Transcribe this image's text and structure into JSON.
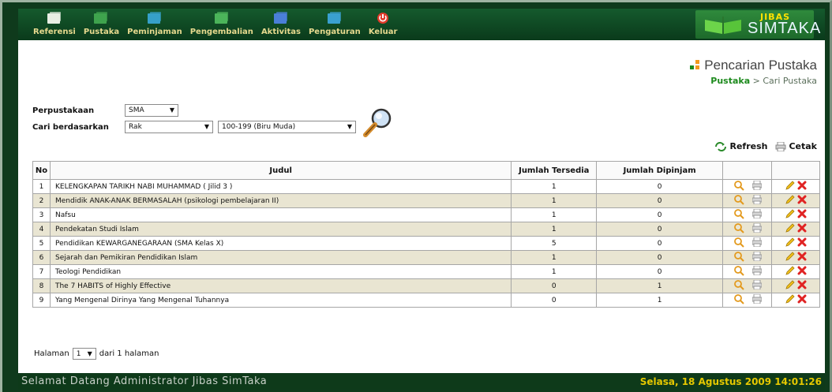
{
  "nav": {
    "items": [
      {
        "label": "Referensi",
        "icon": "referensi-icon"
      },
      {
        "label": "Pustaka",
        "icon": "pustaka-icon"
      },
      {
        "label": "Peminjaman",
        "icon": "peminjaman-icon"
      },
      {
        "label": "Pengembalian",
        "icon": "pengembalian-icon"
      },
      {
        "label": "Aktivitas",
        "icon": "aktivitas-icon"
      },
      {
        "label": "Pengaturan",
        "icon": "pengaturan-icon"
      },
      {
        "label": "Keluar",
        "icon": "power-icon"
      }
    ]
  },
  "logo": {
    "top": "JIBAS",
    "main": "SIMTAKA"
  },
  "page": {
    "title": "Pencarian Pustaka",
    "breadcrumb_link": "Pustaka",
    "breadcrumb_sep": " > ",
    "breadcrumb_current": "Cari Pustaka"
  },
  "filters": {
    "perpustakaan_label": "Perpustakaan",
    "perpustakaan_value": "SMA",
    "cari_label": "Cari berdasarkan",
    "cari_value": "Rak",
    "rak_value": "100-199 (Biru Muda)"
  },
  "actions": {
    "refresh": "Refresh",
    "cetak": "Cetak"
  },
  "table": {
    "headers": {
      "no": "No",
      "judul": "Judul",
      "tersedia": "Jumlah Tersedia",
      "dipinjam": "Jumlah Dipinjam"
    },
    "rows": [
      {
        "no": "1",
        "judul": "KELENGKAPAN TARIKH NABI MUHAMMAD ( Jilid 3 )",
        "tersedia": "1",
        "dipinjam": "0"
      },
      {
        "no": "2",
        "judul": "Mendidik ANAK-ANAK BERMASALAH (psikologi pembelajaran II)",
        "tersedia": "1",
        "dipinjam": "0"
      },
      {
        "no": "3",
        "judul": "Nafsu",
        "tersedia": "1",
        "dipinjam": "0"
      },
      {
        "no": "4",
        "judul": "Pendekatan Studi Islam",
        "tersedia": "1",
        "dipinjam": "0"
      },
      {
        "no": "5",
        "judul": "Pendidikan KEWARGANEGARAAN (SMA Kelas X)",
        "tersedia": "5",
        "dipinjam": "0"
      },
      {
        "no": "6",
        "judul": "Sejarah dan Pemikiran Pendidikan Islam",
        "tersedia": "1",
        "dipinjam": "0"
      },
      {
        "no": "7",
        "judul": "Teologi Pendidikan",
        "tersedia": "1",
        "dipinjam": "0"
      },
      {
        "no": "8",
        "judul": "The 7 HABITS of Highly Effective",
        "tersedia": "0",
        "dipinjam": "1"
      },
      {
        "no": "9",
        "judul": "Yang Mengenal Dirinya Yang Mengenal Tuhannya",
        "tersedia": "0",
        "dipinjam": "1"
      }
    ]
  },
  "pager": {
    "prefix": "Halaman",
    "value": "1",
    "suffix": "dari 1 halaman"
  },
  "footer": {
    "welcome": "Selamat Datang Administrator Jibas SimTaka",
    "date": "Selasa, 18 Agustus 2009 14:01:26"
  },
  "colors": {
    "accent": "#1d8a1d",
    "nav_text": "#e6d98e",
    "row_alt": "#e9e5d2",
    "footer_date": "#e6c800"
  }
}
